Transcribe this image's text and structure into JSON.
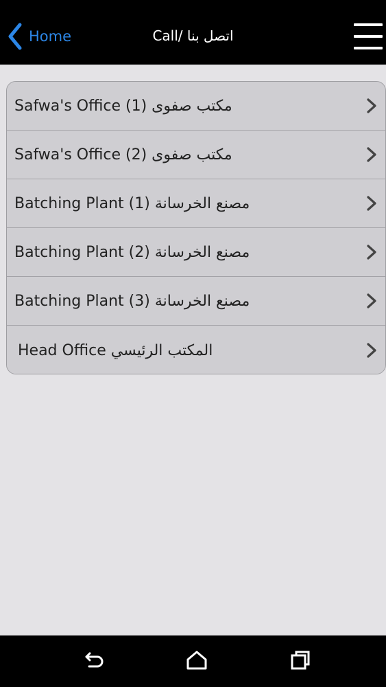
{
  "header": {
    "back_label": "Home",
    "title": "Call/ اتصل بنا"
  },
  "list": {
    "items": [
      {
        "label": "Safwa's Office (1) مكتب صفوى"
      },
      {
        "label": "Safwa's Office (2) مكتب صفوى"
      },
      {
        "label": "Batching Plant (1) مصنع الخرسانة"
      },
      {
        "label": "Batching Plant (2) مصنع الخرسانة"
      },
      {
        "label": "Batching Plant (3) مصنع الخرسانة"
      },
      {
        "label": "Head Office المكتب الرئيسي"
      }
    ]
  },
  "colors": {
    "accent": "#2c86e6",
    "header_bg": "#000000",
    "page_bg": "#e4e3e6",
    "list_bg": "#cfced2"
  },
  "icons": {
    "back": "chevron-left-icon",
    "menu": "hamburger-menu-icon",
    "item": "chevron-right-icon",
    "nav_back": "back-arrow-icon",
    "nav_home": "home-icon",
    "nav_recents": "recent-apps-icon"
  }
}
